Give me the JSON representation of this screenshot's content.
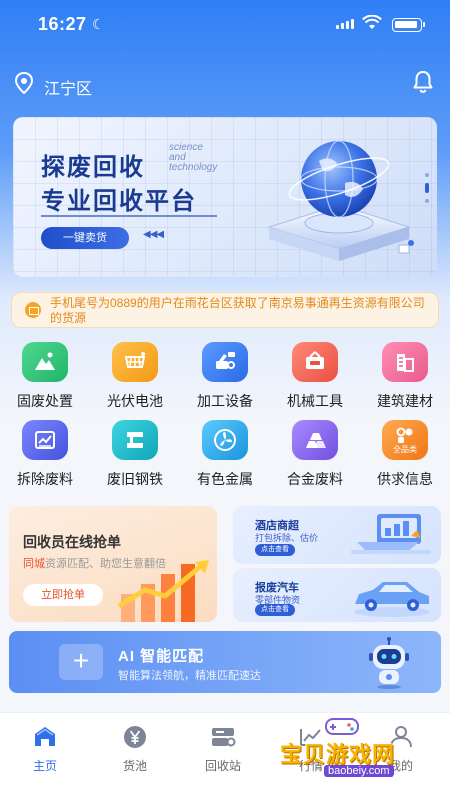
{
  "status": {
    "time": "16:27"
  },
  "header": {
    "location": "江宁区"
  },
  "banner": {
    "title_line1": "探废回收",
    "title_line2": "专业回收平台",
    "tagline": [
      "science",
      "and",
      "technology"
    ],
    "button": "一键卖货",
    "arrows": "◀◀◀"
  },
  "notice": {
    "text": "手机尾号为0889的用户在雨花台区获取了南京易事通再生资源有限公司的货源"
  },
  "categories": [
    {
      "label": "固废处置",
      "icon": "mountain-icon",
      "color": "#28c07a"
    },
    {
      "label": "光伏电池",
      "icon": "solar-panel-icon",
      "color": "#f5a623"
    },
    {
      "label": "加工设备",
      "icon": "machine-icon",
      "color": "#3a7df0"
    },
    {
      "label": "机械工具",
      "icon": "tool-sign-icon",
      "color": "#f0625a"
    },
    {
      "label": "建筑建材",
      "icon": "building-icon",
      "color": "#f06a9a"
    },
    {
      "label": "拆除废料",
      "icon": "demolition-icon",
      "color": "#5a67e8"
    },
    {
      "label": "废旧钢铁",
      "icon": "steel-icon",
      "color": "#16b8c8"
    },
    {
      "label": "有色金属",
      "icon": "fan-icon",
      "color": "#2aa8e8"
    },
    {
      "label": "合金废料",
      "icon": "alloy-icon",
      "color": "#8a63e8"
    },
    {
      "label": "供求信息",
      "icon": "supply-icon",
      "color": "#f58a22",
      "badge": "全品类"
    }
  ],
  "promo": {
    "left": {
      "title": "回收员在线抢单",
      "sub_highlight": "同城",
      "sub_rest": "资源匹配、助您生意翻倍",
      "button": "立即抢单"
    },
    "right_top": {
      "title": "酒店商超",
      "sub": "打包拆除、估价",
      "button": "点击查看"
    },
    "right_bottom": {
      "title": "报废汽车",
      "sub": "零部件物资",
      "button": "点击查看"
    }
  },
  "ai": {
    "title": "AI 智能匹配",
    "subtitle": "智能算法领航，精准匹配速达"
  },
  "tabs": [
    {
      "label": "主页",
      "icon": "home-icon",
      "active": true
    },
    {
      "label": "货池",
      "icon": "yen-icon",
      "active": false
    },
    {
      "label": "回收站",
      "icon": "recycle-station-icon",
      "active": false
    },
    {
      "label": "行情",
      "icon": "market-icon",
      "active": false
    },
    {
      "label": "我的",
      "icon": "profile-icon",
      "active": false
    }
  ],
  "watermark": {
    "text": "宝贝游戏网",
    "url": "baobeiy.com"
  },
  "colors": {
    "primary": "#2f6fe8",
    "accent_orange": "#e6542c",
    "notice_text": "#e48a1c"
  }
}
